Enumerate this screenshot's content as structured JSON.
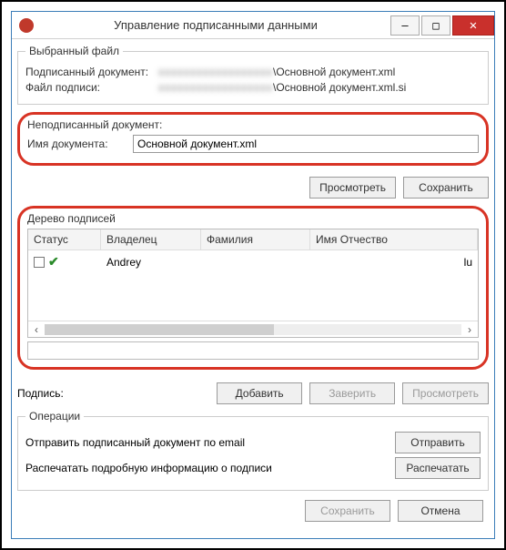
{
  "window": {
    "title": "Управление подписанными данными"
  },
  "selected": {
    "legend": "Выбранный файл",
    "signed_label": "Подписанный документ:",
    "signed_value_suffix": "\\Основной документ.xml",
    "sigfile_label": "Файл подписи:",
    "sigfile_value_suffix": "\\Основной документ.xml.si"
  },
  "unsigned": {
    "title": "Неподписанный документ:",
    "name_label": "Имя документа:",
    "name_value": "Основной документ.xml",
    "view_btn": "Просмотреть",
    "save_btn": "Сохранить"
  },
  "tree": {
    "title": "Дерево подписей",
    "cols": {
      "status": "Статус",
      "owner": "Владелец",
      "last": "Фамилия",
      "name": "Имя Отчество"
    },
    "rows": [
      {
        "owner": "Andrey",
        "last": "",
        "name_trail": "lu"
      }
    ]
  },
  "sig": {
    "label": "Подпись:",
    "add": "Добавить",
    "certify": "Заверить",
    "view": "Просмотреть"
  },
  "ops": {
    "legend": "Операции",
    "email_label": "Отправить подписанный документ по email",
    "email_btn": "Отправить",
    "print_label": "Распечатать подробную информацию о подписи",
    "print_btn": "Распечатать"
  },
  "footer": {
    "save": "Сохранить",
    "cancel": "Отмена"
  }
}
